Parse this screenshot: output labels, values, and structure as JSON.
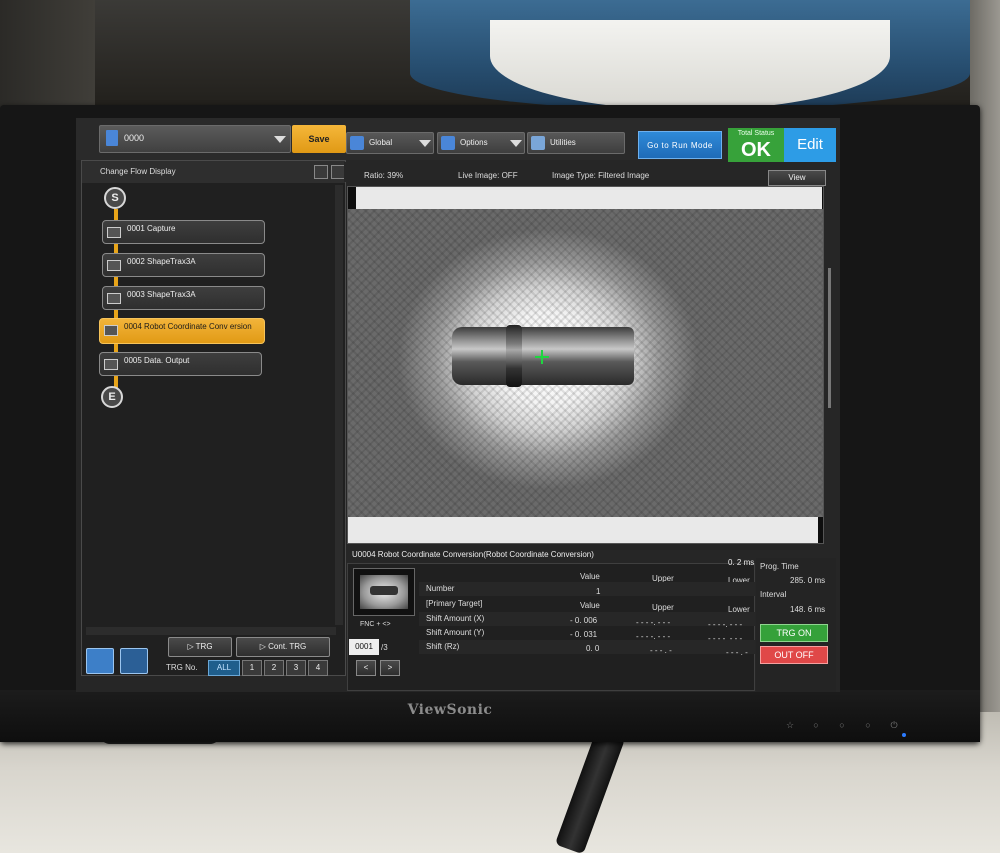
{
  "toolbar": {
    "file": "0000",
    "save": "Save",
    "global": "Global",
    "options": "Options",
    "utilities": "Utilities",
    "run_mode": "Go to Run Mode",
    "total_status_caption": "Total Status",
    "total_status": "OK",
    "edit": "Edit",
    "status_color": "#37a23a",
    "accent_color": "#f2b43a"
  },
  "flow": {
    "header": "Change Flow Display",
    "start": "S",
    "end": "E",
    "items": [
      {
        "label": "0001 Capture",
        "selected": false
      },
      {
        "label": "0002 ShapeTrax3A",
        "selected": false
      },
      {
        "label": "0003 ShapeTrax3A",
        "selected": false
      },
      {
        "label": "0004 Robot Coordinate Conv ersion",
        "selected": true
      },
      {
        "label": "0005 Data. Output",
        "selected": false
      }
    ]
  },
  "controls": {
    "trg": "TRG",
    "cont_trg": "Cont. TRG",
    "trg_no_label": "TRG No.",
    "trg_all": "ALL",
    "trg_nums": [
      "1",
      "2",
      "3",
      "4"
    ]
  },
  "view": {
    "ratio": "Ratio: 39%",
    "live_image": "Live Image: OFF",
    "image_type": "Image Type: Filtered Image",
    "view_button": "View"
  },
  "result": {
    "title": "U0004 Robot Coordinate Conversion(Robot Coordinate Conversion)",
    "elapsed": "0. 2 ms",
    "fnc": "FNC + <>",
    "page": "0001",
    "page_total": "/3",
    "prev": "<",
    "next": ">",
    "headers": {
      "value": "Value",
      "upper": "Upper",
      "lower": "Lower"
    },
    "number_label": "Number",
    "number_value": "1",
    "primary_target": "[Primary Target]",
    "rows": [
      {
        "label": "Shift Amount (X)",
        "value": "- 0. 006",
        "upper": "- - - -. - - -",
        "lower": "- - - -. - - -"
      },
      {
        "label": "Shift Amount (Y)",
        "value": "- 0. 031",
        "upper": "- - - -. - - -",
        "lower": "- - - -. - - -"
      },
      {
        "label": "Shift (Rz)",
        "value": "0. 0",
        "upper": "- - - . -",
        "lower": "- - - . -"
      }
    ]
  },
  "timing": {
    "prog_time_label": "Prog. Time",
    "prog_time": "285. 0 ms",
    "interval_label": "Interval",
    "interval": "148. 6 ms",
    "trg_on": "TRG ON",
    "out_off": "OUT OFF"
  },
  "monitor": {
    "brand": "ViewSonic"
  }
}
